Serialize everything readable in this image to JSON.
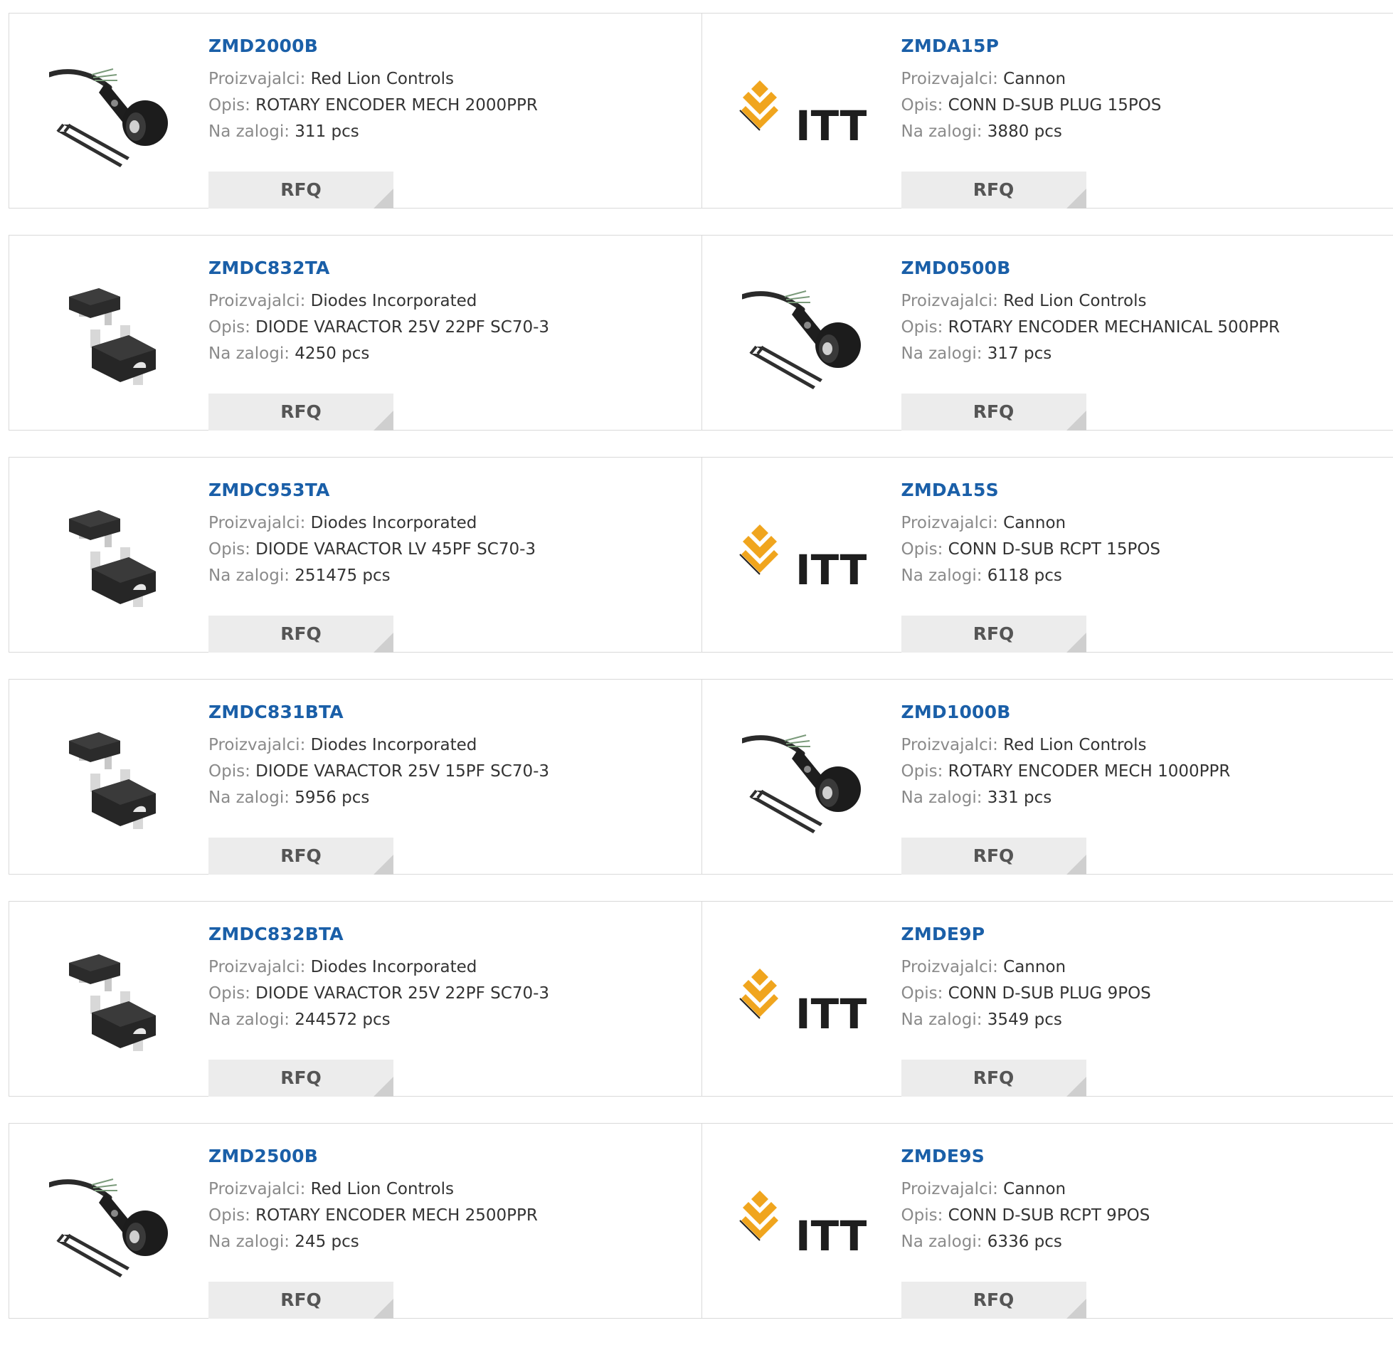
{
  "labels": {
    "manufacturer": "Proizvajalci:",
    "description": "Opis:",
    "stock": "Na zalogi:",
    "rfq": "RFQ"
  },
  "colors": {
    "part_link": "#1a5fa8",
    "label": "#8a8a8a",
    "button_bg": "#ececec",
    "border": "#d9d9d9",
    "itt_logo": "#f0a51e"
  },
  "products": [
    {
      "part": "ZMD2000B",
      "manufacturer": "Red Lion Controls",
      "description": "ROTARY ENCODER MECH 2000PPR",
      "stock": "311 pcs",
      "image": "encoder-image"
    },
    {
      "part": "ZMDA15P",
      "manufacturer": "Cannon",
      "description": "CONN D-SUB PLUG 15POS",
      "stock": "3880 pcs",
      "image": "itt-logo",
      "logo_text": "ITT"
    },
    {
      "part": "ZMDC832TA",
      "manufacturer": "Diodes Incorporated",
      "description": "DIODE VARACTOR 25V 22PF SC70-3",
      "stock": "4250 pcs",
      "image": "sc70-package-image"
    },
    {
      "part": "ZMD0500B",
      "manufacturer": "Red Lion Controls",
      "description": "ROTARY ENCODER MECHANICAL 500PPR",
      "stock": "317 pcs",
      "image": "encoder-image"
    },
    {
      "part": "ZMDC953TA",
      "manufacturer": "Diodes Incorporated",
      "description": "DIODE VARACTOR LV 45PF SC70-3",
      "stock": "251475 pcs",
      "image": "sc70-package-image"
    },
    {
      "part": "ZMDA15S",
      "manufacturer": "Cannon",
      "description": "CONN D-SUB RCPT 15POS",
      "stock": "6118 pcs",
      "image": "itt-logo",
      "logo_text": "ITT"
    },
    {
      "part": "ZMDC831BTA",
      "manufacturer": "Diodes Incorporated",
      "description": "DIODE VARACTOR 25V 15PF SC70-3",
      "stock": "5956 pcs",
      "image": "sc70-package-image"
    },
    {
      "part": "ZMD1000B",
      "manufacturer": "Red Lion Controls",
      "description": "ROTARY ENCODER MECH 1000PPR",
      "stock": "331 pcs",
      "image": "encoder-image"
    },
    {
      "part": "ZMDC832BTA",
      "manufacturer": "Diodes Incorporated",
      "description": "DIODE VARACTOR 25V 22PF SC70-3",
      "stock": "244572 pcs",
      "image": "sc70-package-image"
    },
    {
      "part": "ZMDE9P",
      "manufacturer": "Cannon",
      "description": "CONN D-SUB PLUG 9POS",
      "stock": "3549 pcs",
      "image": "itt-logo",
      "logo_text": "ITT"
    },
    {
      "part": "ZMD2500B",
      "manufacturer": "Red Lion Controls",
      "description": "ROTARY ENCODER MECH 2500PPR",
      "stock": "245 pcs",
      "image": "encoder-image"
    },
    {
      "part": "ZMDE9S",
      "manufacturer": "Cannon",
      "description": "CONN D-SUB RCPT 9POS",
      "stock": "6336 pcs",
      "image": "itt-logo",
      "logo_text": "ITT"
    }
  ]
}
